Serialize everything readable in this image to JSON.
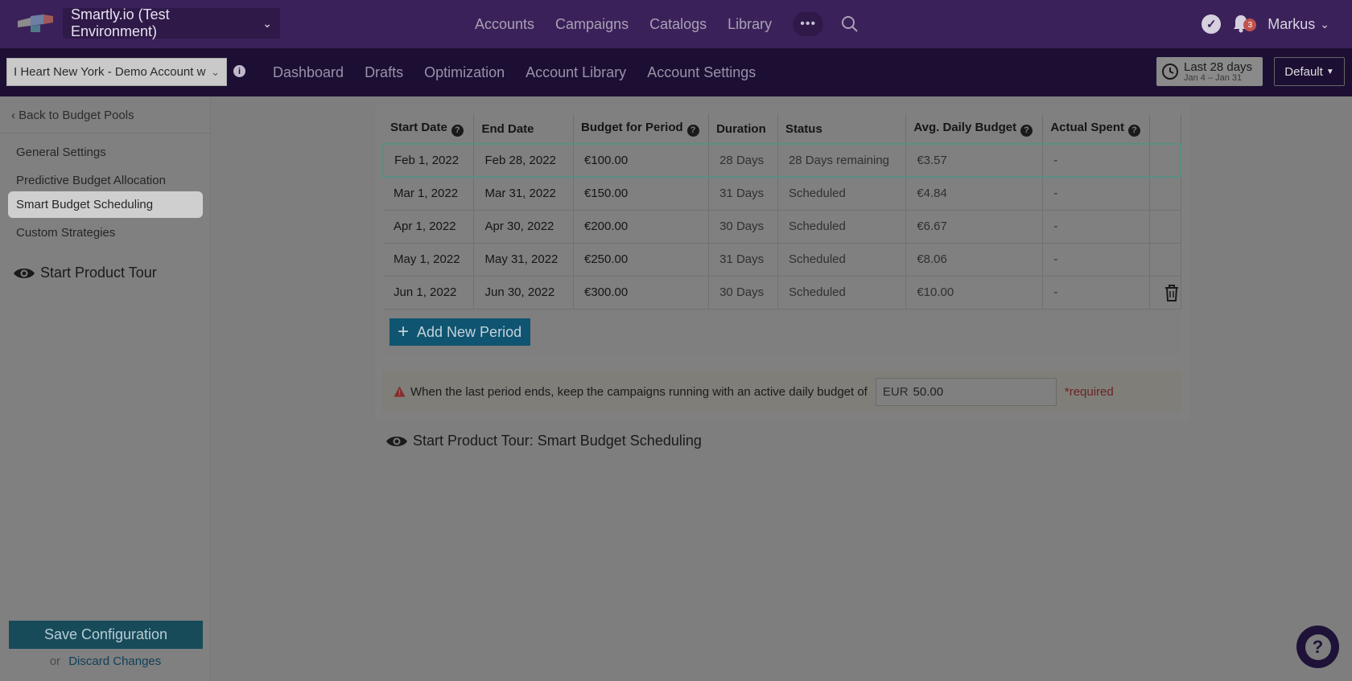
{
  "topbar": {
    "environment": "Smartly.io (Test Environment)",
    "nav": [
      "Accounts",
      "Campaigns",
      "Catalogs",
      "Library"
    ],
    "more_label": "•••",
    "notification_count": "3",
    "user_name": "Markus"
  },
  "subbar": {
    "account": "I Heart New York - Demo Account w",
    "nav": [
      "Dashboard",
      "Drafts",
      "Optimization",
      "Account Library",
      "Account Settings"
    ],
    "date_range": {
      "label": "Last 28 days",
      "dates": "Jan 4 – Jan 31"
    },
    "view_select": "Default"
  },
  "sidebar": {
    "back_label": "Back to Budget Pools",
    "items": [
      "General Settings",
      "Predictive Budget Allocation",
      "Smart Budget Scheduling",
      "Custom Strategies"
    ],
    "active_item": "Smart Budget Scheduling",
    "tour_label": "Start Product Tour",
    "save_label": "Save Configuration",
    "or_label": "or",
    "discard_label": "Discard Changes"
  },
  "table": {
    "headers": [
      "Start Date",
      "End Date",
      "Budget for Period",
      "Duration",
      "Status",
      "Avg. Daily Budget",
      "Actual Spent"
    ],
    "rows": [
      {
        "start": "Feb 1, 2022",
        "end": "Feb 28, 2022",
        "budget": "€100.00",
        "duration": "28 Days",
        "status": "28 Days remaining",
        "avg": "€3.57",
        "spent": "-"
      },
      {
        "start": "Mar 1, 2022",
        "end": "Mar 31, 2022",
        "budget": "€150.00",
        "duration": "31 Days",
        "status": "Scheduled",
        "avg": "€4.84",
        "spent": "-"
      },
      {
        "start": "Apr 1, 2022",
        "end": "Apr 30, 2022",
        "budget": "€200.00",
        "duration": "30 Days",
        "status": "Scheduled",
        "avg": "€6.67",
        "spent": "-"
      },
      {
        "start": "May 1, 2022",
        "end": "May 31, 2022",
        "budget": "€250.00",
        "duration": "31 Days",
        "status": "Scheduled",
        "avg": "€8.06",
        "spent": "-"
      },
      {
        "start": "Jun 1, 2022",
        "end": "Jun 30, 2022",
        "budget": "€300.00",
        "duration": "30 Days",
        "status": "Scheduled",
        "avg": "€10.00",
        "spent": "-"
      }
    ]
  },
  "add_period_label": "Add New Period",
  "fallback": {
    "text": "When the last period ends, keep the campaigns running with an active daily budget of",
    "currency": "EUR",
    "value": "50.00",
    "required_label": "*required"
  },
  "tour_main_label": "Start Product Tour: Smart Budget Scheduling",
  "colors": {
    "topbar": "#3b2159",
    "subbar": "#1d0f33",
    "accent": "#0f5470"
  }
}
